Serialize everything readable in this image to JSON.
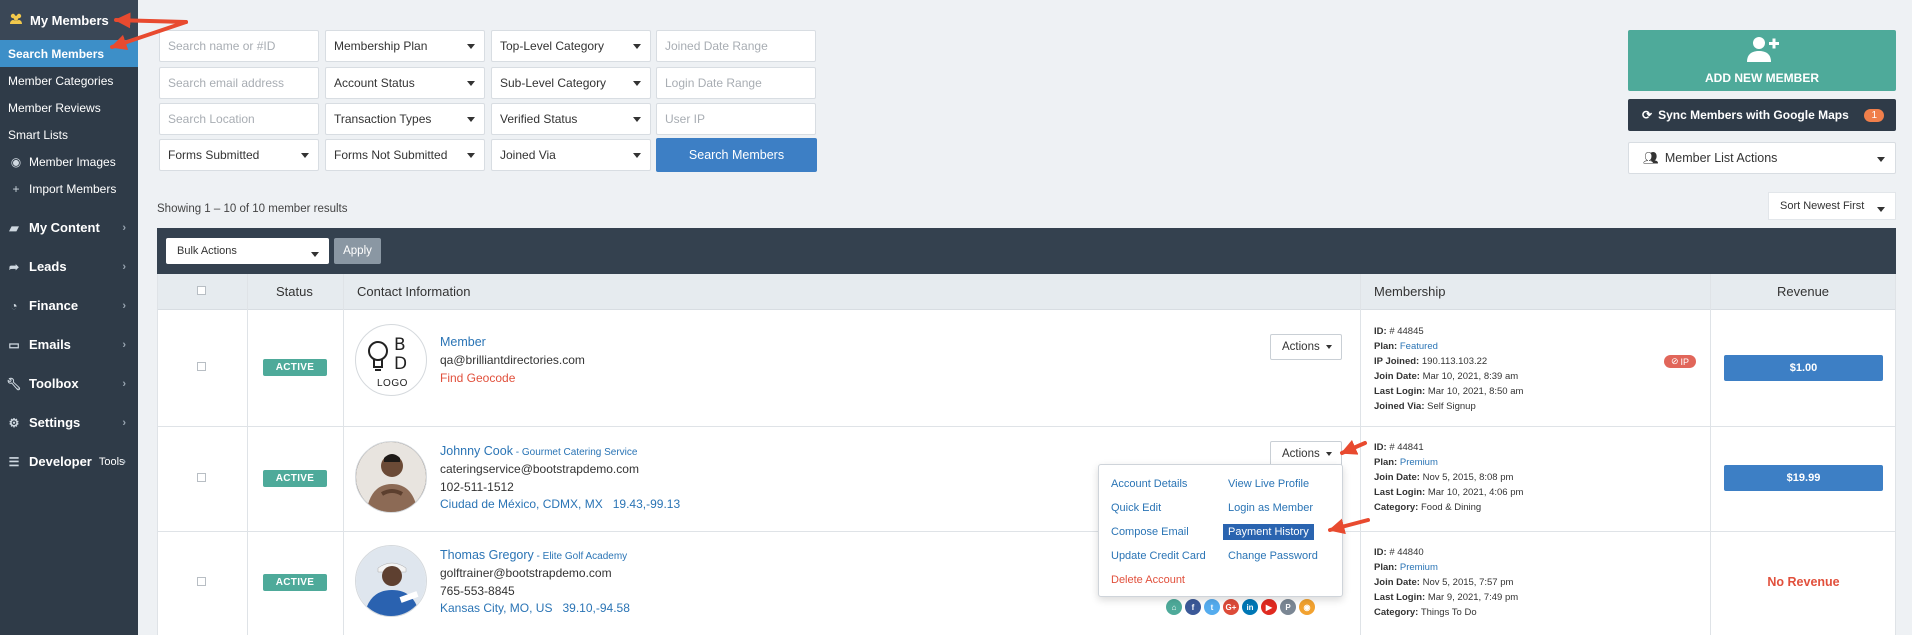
{
  "sidebar": {
    "header": "My Members",
    "sub_items": [
      {
        "label": "Search Members",
        "active": true
      },
      {
        "label": "Member Categories"
      },
      {
        "label": "Member Reviews"
      },
      {
        "label": "Smart Lists"
      },
      {
        "label": "Member Images",
        "icon": "user-circle-icon"
      },
      {
        "label": "Import Members",
        "icon": "plus-icon"
      }
    ],
    "main_items": [
      {
        "label": "My Content",
        "icon": "folder-icon"
      },
      {
        "label": "Leads",
        "icon": "share-icon"
      },
      {
        "label": "Finance",
        "icon": "pie-chart-icon"
      },
      {
        "label": "Emails",
        "icon": "inbox-icon"
      },
      {
        "label": "Toolbox",
        "icon": "wrench-icon"
      },
      {
        "label": "Settings",
        "icon": "gear-icon"
      },
      {
        "label": "Developer",
        "suffix": "Tools",
        "icon": "sliders-icon"
      }
    ]
  },
  "filters": {
    "search_name": "Search name or #ID",
    "membership_plan": "Membership Plan",
    "top_category": "Top-Level Category",
    "joined_range": "Joined Date Range",
    "search_email": "Search email address",
    "account_status": "Account Status",
    "sub_category": "Sub-Level Category",
    "login_range": "Login Date Range",
    "search_location": "Search Location",
    "transaction_types": "Transaction Types",
    "verified_status": "Verified Status",
    "user_ip": "User IP",
    "forms_submitted": "Forms Submitted",
    "forms_not_submitted": "Forms Not Submitted",
    "joined_via": "Joined Via",
    "search_button": "Search Members"
  },
  "right": {
    "add_member": "ADD NEW MEMBER",
    "sync": "Sync Members with Google Maps",
    "sync_count": "1",
    "list_actions": "Member List Actions",
    "sort": "Sort Newest First"
  },
  "results": {
    "showing": "Showing 1 – 10 of 10 member results",
    "bulk_actions": "Bulk Actions",
    "apply": "Apply"
  },
  "columns": {
    "status": "Status",
    "contact": "Contact Information",
    "membership": "Membership",
    "revenue": "Revenue"
  },
  "rows": [
    {
      "status": "ACTIVE",
      "logo": {
        "top": "B",
        "mid": "D",
        "bottom": "LOGO"
      },
      "name": "Member",
      "business": "",
      "email": "qa@brilliantdirectories.com",
      "phone": "",
      "location": "",
      "geo": "",
      "red_link": "Find Geocode",
      "actions": "Actions",
      "id": "# 44845",
      "plan": "Featured",
      "ip_joined": "190.113.103.22",
      "join_date": "Mar 10, 2021, 8:39 am",
      "last_login": "Mar 10, 2021, 8:50 am",
      "extra_label": "Joined Via:",
      "extra_value": "Self Signup",
      "ip_badge": "IP",
      "revenue": "$1.00"
    },
    {
      "status": "ACTIVE",
      "name": "Johnny Cook",
      "business": " - Gourmet Catering Service",
      "email": "cateringservice@bootstrapdemo.com",
      "phone": "102-511-1512",
      "location": "Ciudad de México, CDMX, MX",
      "geo": "19.43,-99.13",
      "actions": "Actions",
      "id": "# 44841",
      "plan": "Premium",
      "join_date": "Nov 5, 2015, 8:08 pm",
      "last_login": "Mar 10, 2021, 4:06 pm",
      "extra_label": "Category:",
      "extra_value": "Food & Dining",
      "revenue": "$19.99"
    },
    {
      "status": "ACTIVE",
      "name": "Thomas Gregory",
      "business": " - Elite Golf Academy",
      "email": "golftrainer@bootstrapdemo.com",
      "phone": "765-553-8845",
      "location": "Kansas City, MO, US",
      "geo": "39.10,-94.58",
      "id": "# 44840",
      "plan": "Premium",
      "join_date": "Nov 5, 2015, 7:57 pm",
      "last_login": "Mar 9, 2021, 7:49 pm",
      "extra_label": "Category:",
      "extra_value": "Things To Do",
      "revenue": "No Revenue"
    }
  ],
  "membership_labels": {
    "id": "ID:",
    "plan": "Plan:",
    "ip_joined": "IP Joined:",
    "join_date": "Join Date:",
    "last_login": "Last Login:"
  },
  "actions_menu": {
    "account_details": "Account Details",
    "view_live_profile": "View Live Profile",
    "quick_edit": "Quick Edit",
    "login_as_member": "Login as Member",
    "compose_email": "Compose Email",
    "payment_history": "Payment History",
    "update_credit_card": "Update Credit Card",
    "change_password": "Change Password",
    "delete_account": "Delete Account"
  },
  "social_icons": [
    {
      "name": "home-icon",
      "color": "#4eaa9a",
      "glyph": "⌂"
    },
    {
      "name": "facebook-icon",
      "color": "#3b5998",
      "glyph": "f"
    },
    {
      "name": "twitter-icon",
      "color": "#55acee",
      "glyph": "t"
    },
    {
      "name": "google-plus-icon",
      "color": "#dd4b39",
      "glyph": "G+"
    },
    {
      "name": "linkedin-icon",
      "color": "#0077b5",
      "glyph": "in"
    },
    {
      "name": "youtube-icon",
      "color": "#e02a20",
      "glyph": "▶"
    },
    {
      "name": "pinterest-icon",
      "color": "#7b8794",
      "glyph": "P"
    },
    {
      "name": "rss-icon",
      "color": "#f2a230",
      "glyph": "◉"
    }
  ],
  "colors": {
    "sidebar": "#2f3b48",
    "active_nav": "#3d8fc8",
    "primary": "#3d7fc5",
    "success": "#4eaa9a",
    "danger": "#e1503c",
    "annotation_arrow": "#e84a2f"
  }
}
